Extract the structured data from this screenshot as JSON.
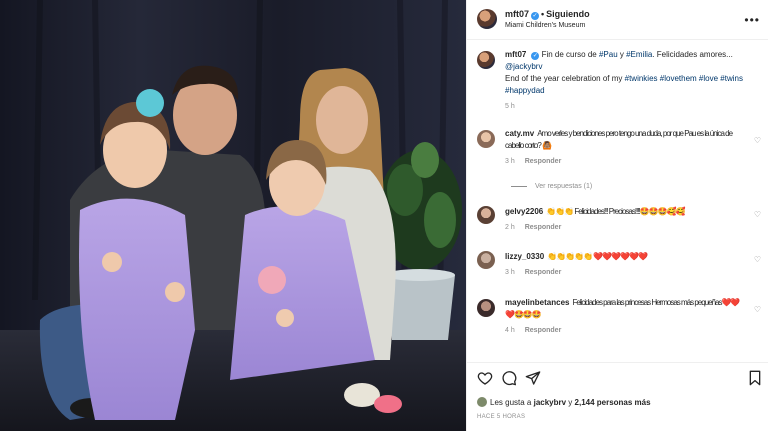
{
  "post": {
    "username": "mft07",
    "verified_mark": "✓",
    "separator": "•",
    "follow_label": "Siguiendo",
    "location": "Miami Children's Museum",
    "more_icon": "more-horizontal-icon"
  },
  "caption": {
    "username": "mft07",
    "text_es_1": "Fin de curso de ",
    "tag_pau": "#Pau",
    "text_y": " y ",
    "tag_emilia": "#Emilia",
    "text_es_2": ". Felicidades amores... ",
    "mention": "@jackybrv",
    "text_en": "End of the year celebration of my ",
    "tag_twinkies": "#twinkies",
    "tag_lovethem": "#lovethem",
    "tag_love": "#love",
    "tag_twins": "#twins",
    "tag_happydad": "#happydad",
    "time": "5 h"
  },
  "comments": [
    {
      "username": "caty.mv",
      "text": "Amo verles y bendiciones pero tengo una duda, por que Pau es la única de cabello corto? 🙆🏽",
      "time": "3 h",
      "reply": "Responder",
      "replies": "Ver respuestas (1)"
    },
    {
      "username": "gelvy2206",
      "text": "👏👏👏 Felicidades!!! Preciosas!!!!🤩🤩🤩🥰🥰",
      "time": "2 h",
      "reply": "Responder"
    },
    {
      "username": "lizzy_0330",
      "text": "👏👏👏👏👏 ❤️❤️❤️❤️❤️❤️",
      "time": "3 h",
      "reply": "Responder"
    },
    {
      "username": "mayelinbetances",
      "text": "Felicidades para las princesas Hermosas más pequeñas❤️❤️❤️🤩🤩🤩",
      "time": "4 h",
      "reply": "Responder"
    }
  ],
  "actions": {
    "like_icon": "heart-icon",
    "comment_icon": "comment-icon",
    "share_icon": "send-icon",
    "save_icon": "bookmark-icon"
  },
  "likes": {
    "prefix": "Les gusta a ",
    "user": "jackybrv",
    "middle": " y ",
    "count": "2,144 personas más"
  },
  "timestamp": "HACE 5 HORAS",
  "colors": {
    "link": "#00376b",
    "verified": "#3897f0",
    "muted": "#8e8e8e",
    "text": "#262626"
  }
}
